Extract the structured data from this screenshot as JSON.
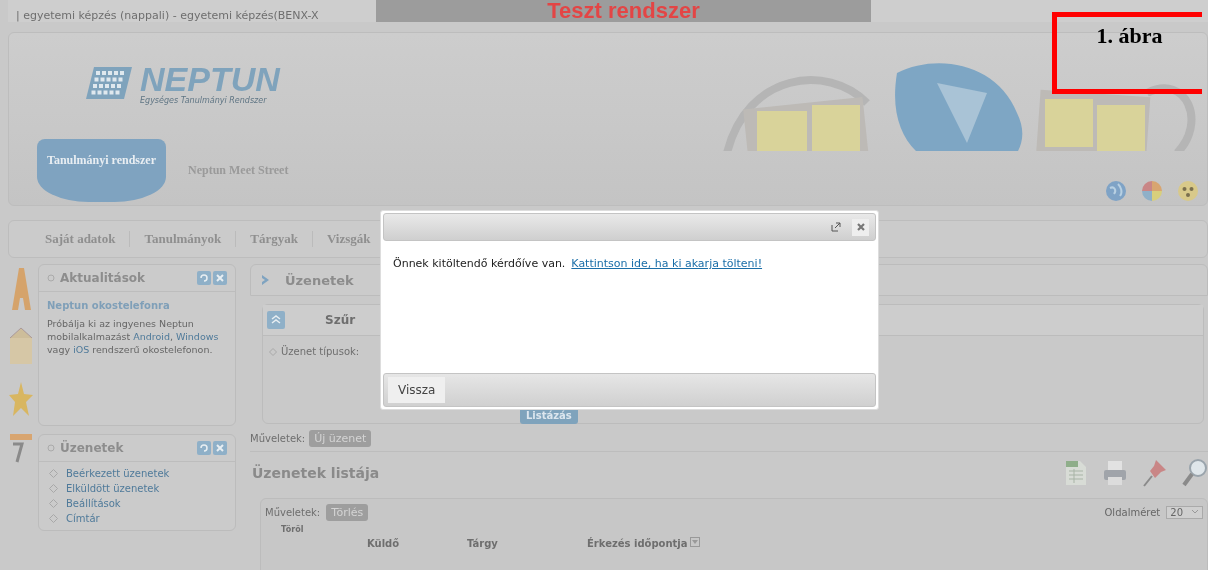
{
  "header": {
    "program_line": "| egyetemi képzés (nappali) - egyetemi képzés(BENX-X",
    "test_banner": "Teszt rendszer",
    "logo_title": "NEPTUN",
    "logo_subtitle": "Egységes Tanulmányi Rendszer"
  },
  "system_tabs": [
    {
      "label": "Tanulmányi rendszer",
      "selected": true
    },
    {
      "label": "Neptun Meet Street",
      "selected": false
    }
  ],
  "figure_label": "1. ábra",
  "menu": [
    "Saját adatok",
    "Tanulmányok",
    "Tárgyak",
    "Vizsgák"
  ],
  "sidebar": {
    "news": {
      "title": "Aktualitások",
      "heading": "Neptun okostelefonra",
      "segments": [
        {
          "text": "Próbálja ki az ingyenes Neptun mobilalkalmazást ",
          "link": false
        },
        {
          "text": "Android",
          "link": true
        },
        {
          "text": ", ",
          "link": false
        },
        {
          "text": "Windows",
          "link": true
        },
        {
          "text": " vagy ",
          "link": false
        },
        {
          "text": "iOS",
          "link": true
        },
        {
          "text": " rendszerű okostelefonon.",
          "link": false
        }
      ]
    },
    "messages": {
      "title": "Üzenetek",
      "links": [
        "Beérkezett üzenetek",
        "Elküldött üzenetek",
        "Beállítások",
        "Címtár"
      ]
    }
  },
  "main": {
    "title": "Üzenetek",
    "filter": {
      "title": "Szűr",
      "label": "Üzenet típusok:",
      "button": "Listázás"
    },
    "actions": {
      "label": "Műveletek:",
      "button": "Új üzenet"
    },
    "list_title": "Üzenetek listája",
    "table": {
      "actions_label": "Műveletek:",
      "delete_button": "Törlés",
      "page_size_label": "Oldalméret",
      "page_size": "20",
      "columns": [
        "Töröl",
        "Küldő",
        "Tárgy",
        "Érkezés időpontja"
      ]
    }
  },
  "dialog": {
    "message": "Önnek kitöltendő kérdőíve van.",
    "link": "Kattintson ide, ha ki akarja tölteni!",
    "button": "Vissza"
  }
}
